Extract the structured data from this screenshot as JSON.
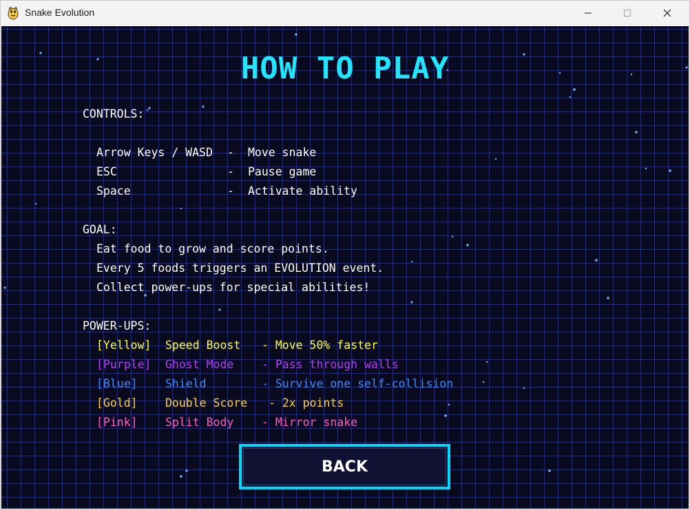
{
  "window": {
    "title": "Snake Evolution",
    "icon": "python-snake-icon",
    "controls": [
      "minimize-icon",
      "maximize-icon",
      "close-icon"
    ]
  },
  "screen": {
    "heading": "HOW TO PLAY",
    "heading_color": "#22e6ff",
    "background_color": "#0a0a1e",
    "grid_color": "#3a4bb9"
  },
  "controls_section": {
    "title": "CONTROLS:",
    "rows": [
      {
        "key": "Arrow Keys / WASD",
        "sep": "-",
        "action": "Move snake"
      },
      {
        "key": "ESC",
        "sep": "-",
        "action": "Pause game"
      },
      {
        "key": "Space",
        "sep": "-",
        "action": "Activate ability"
      }
    ]
  },
  "goal_section": {
    "title": "GOAL:",
    "lines": [
      "Eat food to grow and score points.",
      "Every 5 foods triggers an EVOLUTION event.",
      "Collect power-ups for special abilities!"
    ]
  },
  "powerups_section": {
    "title": "POWER-UPS:",
    "items": [
      {
        "tag": "[Yellow]",
        "name": "Speed Boost",
        "desc": "- Move 50% faster",
        "color": "#ffff3c"
      },
      {
        "tag": "[Purple]",
        "name": "Ghost Mode",
        "desc": "- Pass through walls",
        "color": "#b43cff"
      },
      {
        "tag": "[Blue]",
        "name": "Shield",
        "desc": "- Survive one self-collision",
        "color": "#3c8cff"
      },
      {
        "tag": "[Gold]",
        "name": "Double Score",
        "desc": "- 2x points",
        "color": "#ffd23c"
      },
      {
        "tag": "[Pink]",
        "name": "Split Body",
        "desc": "- Mirror snake",
        "color": "#ff5ac8"
      }
    ]
  },
  "back_button": {
    "label": "BACK",
    "border_color": "#00d8ff"
  }
}
